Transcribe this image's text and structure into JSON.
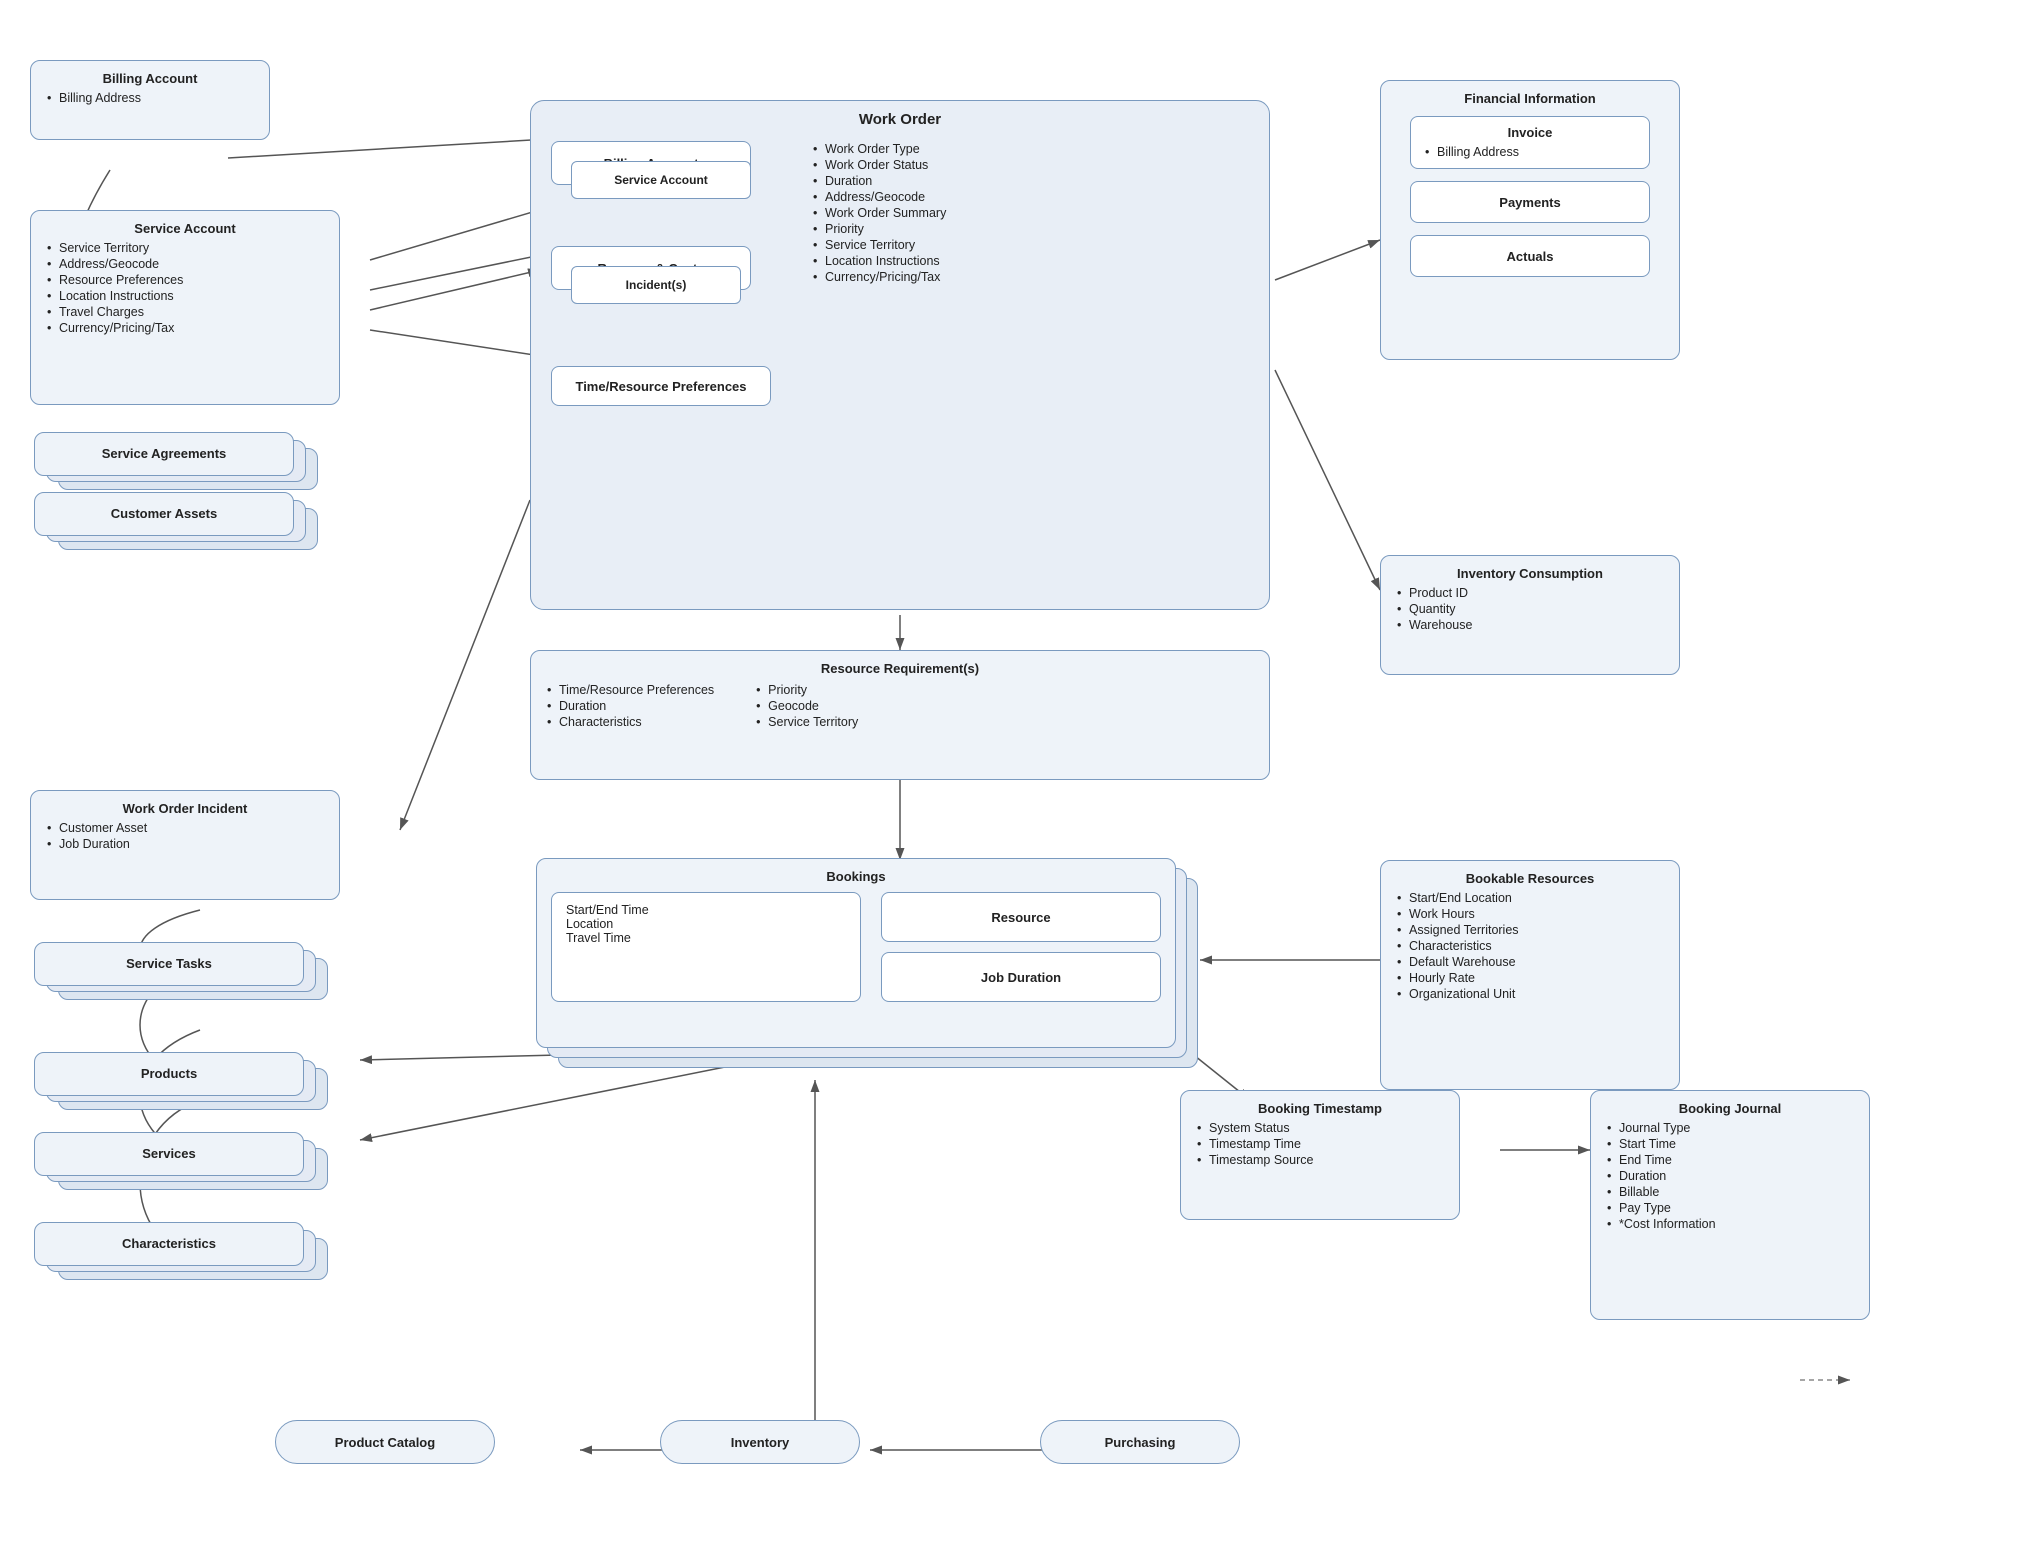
{
  "billing_account_top": {
    "title": "Billing Account",
    "items": [
      "Billing Address"
    ]
  },
  "service_account": {
    "title": "Service Account",
    "items": [
      "Service Territory",
      "Address/Geocode",
      "Resource Preferences",
      "Location Instructions",
      "Travel Charges",
      "Currency/Pricing/Tax"
    ]
  },
  "service_agreements": {
    "title": "Service Agreements"
  },
  "customer_assets": {
    "title": "Customer Assets"
  },
  "work_order_incident": {
    "title": "Work Order Incident",
    "items": [
      "Customer Asset",
      "Job Duration"
    ]
  },
  "service_tasks": {
    "title": "Service Tasks"
  },
  "products": {
    "title": "Products"
  },
  "services": {
    "title": "Services"
  },
  "characteristics_left": {
    "title": "Characteristics"
  },
  "product_catalog": {
    "title": "Product Catalog"
  },
  "inventory": {
    "title": "Inventory"
  },
  "purchasing": {
    "title": "Purchasing"
  },
  "work_order": {
    "title": "Work Order",
    "items": [
      "Work Order Type",
      "Work Order Status",
      "Duration",
      "Address/Geocode",
      "Work Order Summary",
      "Priority",
      "Service Territory",
      "Location Instructions",
      "Currency/Pricing/Tax"
    ]
  },
  "billing_account_inner": {
    "title": "Billing Account"
  },
  "service_account_inner": {
    "title": "Service Account"
  },
  "revenue_costs": {
    "title": "Revenue & Costs"
  },
  "incidents": {
    "title": "Incident(s)"
  },
  "time_resource": {
    "title": "Time/Resource Preferences"
  },
  "resource_requirements": {
    "title": "Resource Requirement(s)",
    "items_left": [
      "Time/Resource Preferences",
      "Duration",
      "Characteristics"
    ],
    "items_right": [
      "Priority",
      "Geocode",
      "Service Territory"
    ]
  },
  "bookings": {
    "title": "Bookings",
    "items": [
      "Start/End Time",
      "Location",
      "Travel Time"
    ]
  },
  "resource_inner": {
    "title": "Resource"
  },
  "job_duration_inner": {
    "title": "Job Duration"
  },
  "financial_info": {
    "title": "Financial Information"
  },
  "invoice": {
    "title": "Invoice",
    "items": [
      "Billing Address"
    ]
  },
  "payments": {
    "title": "Payments"
  },
  "actuals": {
    "title": "Actuals"
  },
  "inventory_consumption": {
    "title": "Inventory Consumption",
    "items": [
      "Product ID",
      "Quantity",
      "Warehouse"
    ]
  },
  "bookable_resources": {
    "title": "Bookable Resources",
    "items": [
      "Start/End Location",
      "Work Hours",
      "Assigned Territories",
      "Characteristics",
      "Default Warehouse",
      "Hourly Rate",
      "Organizational Unit"
    ]
  },
  "booking_timestamp": {
    "title": "Booking Timestamp",
    "items": [
      "System Status",
      "Timestamp Time",
      "Timestamp Source"
    ]
  },
  "booking_journal": {
    "title": "Booking Journal",
    "items": [
      "Journal Type",
      "Start Time",
      "End Time",
      "Duration",
      "Billable",
      "Pay Type",
      "*Cost Information"
    ]
  }
}
